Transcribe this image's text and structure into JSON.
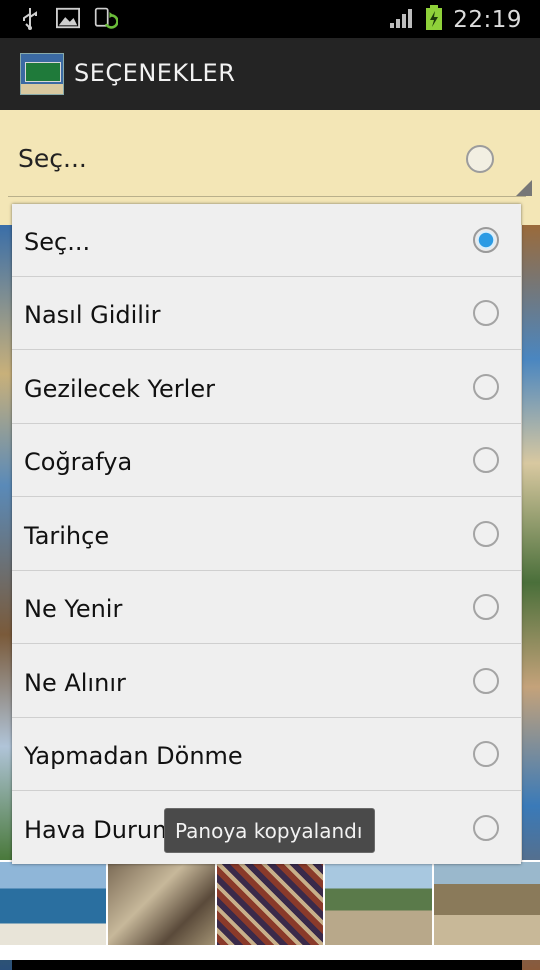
{
  "status_bar": {
    "time": "22:19",
    "icons": [
      "usb-icon",
      "image-icon",
      "sync-icon",
      "signal-icon",
      "battery-charging-icon"
    ]
  },
  "action_bar": {
    "title": "SEÇENEKLER",
    "logo_icon": "app-logo-icon"
  },
  "spinner": {
    "selected_text": "Seç..."
  },
  "dialog": {
    "options": [
      {
        "label": "Seç...",
        "selected": true
      },
      {
        "label": "Nasıl Gidilir",
        "selected": false
      },
      {
        "label": "Gezilecek Yerler",
        "selected": false
      },
      {
        "label": "Coğrafya",
        "selected": false
      },
      {
        "label": "Tarihçe",
        "selected": false
      },
      {
        "label": "Ne Yenir",
        "selected": false
      },
      {
        "label": "Ne Alınır",
        "selected": false
      },
      {
        "label": "Yapmadan Dönme",
        "selected": false
      },
      {
        "label": "Hava Durumu",
        "selected": false
      }
    ]
  },
  "toast": {
    "text": "Panoya kopyalandı"
  },
  "colors": {
    "accent": "#2b9be4",
    "spinner_bg": "#f3e6b6",
    "dialog_bg": "#efefef"
  }
}
